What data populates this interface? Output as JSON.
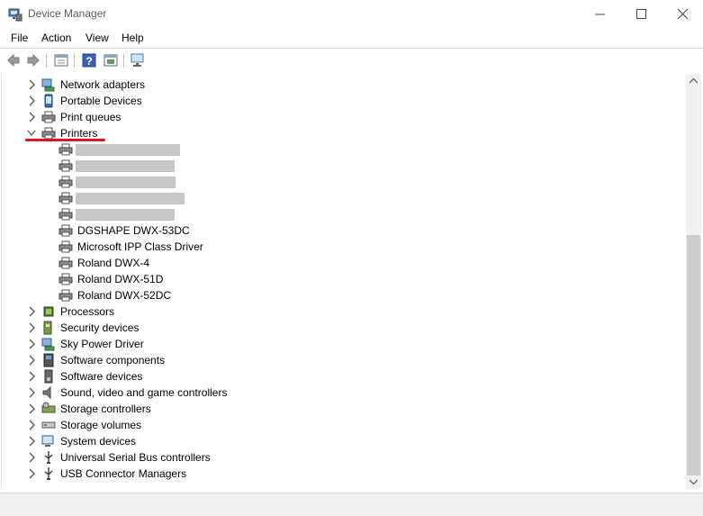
{
  "window": {
    "title": "Device Manager"
  },
  "menu": [
    "File",
    "Action",
    "View",
    "Help"
  ],
  "tree": {
    "categories_top": [
      {
        "label": "Network adapters",
        "icon": "network-adapter-icon"
      },
      {
        "label": "Portable Devices",
        "icon": "portable-device-icon"
      },
      {
        "label": "Print queues",
        "icon": "printer-icon"
      },
      {
        "label": "Printers",
        "icon": "printer-icon",
        "expanded": true
      }
    ],
    "printers": [
      "DGSHAPE DWX-53DC",
      "Microsoft IPP Class Driver",
      "Roland DWX-4",
      "Roland DWX-51D",
      "Roland DWX-52DC"
    ],
    "categories_bottom": [
      {
        "label": "Processors",
        "icon": "processor-icon"
      },
      {
        "label": "Security devices",
        "icon": "security-device-icon"
      },
      {
        "label": "Sky Power Driver",
        "icon": "network-adapter-icon"
      },
      {
        "label": "Software components",
        "icon": "software-component-icon"
      },
      {
        "label": "Software devices",
        "icon": "software-device-icon"
      },
      {
        "label": "Sound, video and game controllers",
        "icon": "speaker-icon"
      },
      {
        "label": "Storage controllers",
        "icon": "storage-controller-icon"
      },
      {
        "label": "Storage volumes",
        "icon": "storage-volume-icon"
      },
      {
        "label": "System devices",
        "icon": "system-device-icon"
      },
      {
        "label": "Universal Serial Bus controllers",
        "icon": "usb-icon"
      },
      {
        "label": "USB Connector Managers",
        "icon": "usb-icon"
      }
    ]
  },
  "colors": {
    "annotation_underline": "#e0141e",
    "redaction": "#c7c7c7"
  }
}
